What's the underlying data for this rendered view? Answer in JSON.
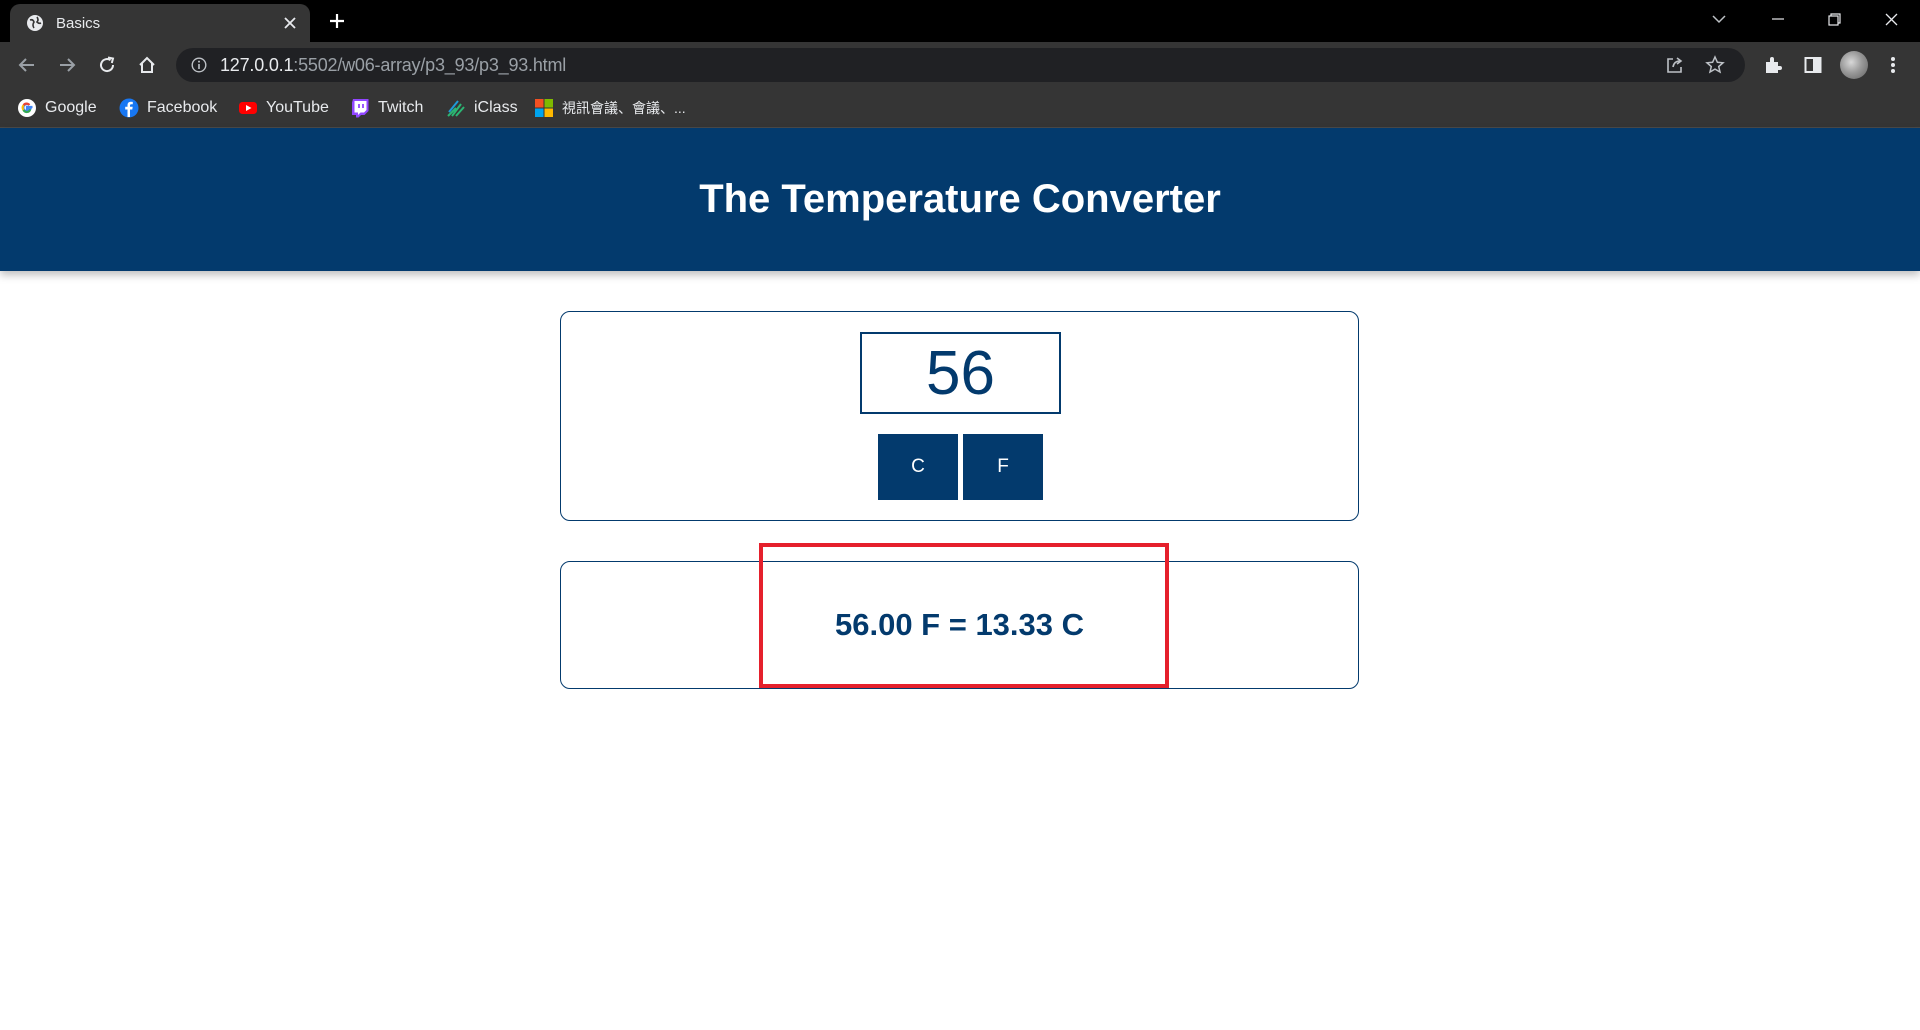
{
  "browser": {
    "tab": {
      "title": "Basics"
    },
    "address": {
      "host": "127.0.0.1",
      "path": ":5502/w06-array/p3_93/p3_93.html"
    },
    "bookmarks": [
      {
        "label": "Google",
        "icon": "google-icon"
      },
      {
        "label": "Facebook",
        "icon": "facebook-icon"
      },
      {
        "label": "YouTube",
        "icon": "youtube-icon"
      },
      {
        "label": "Twitch",
        "icon": "twitch-icon"
      },
      {
        "label": "iClass",
        "icon": "iclass-icon"
      },
      {
        "label": "視訊會議、會議、...",
        "icon": "microsoft-icon"
      }
    ]
  },
  "page": {
    "title": "The Temperature Converter",
    "input_value": "56",
    "buttons": {
      "c": "C",
      "f": "F"
    },
    "result": "56.00 F = 13.33 C"
  },
  "colors": {
    "header_bg": "#033a6d",
    "accent": "#033a6d",
    "highlight": "#e5202c"
  }
}
